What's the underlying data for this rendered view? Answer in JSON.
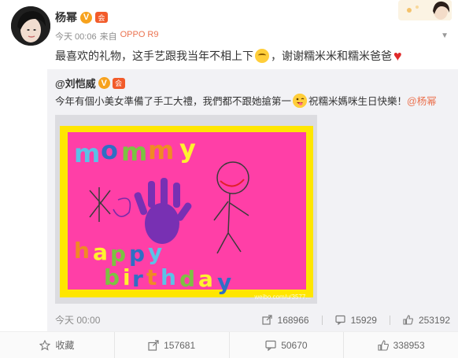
{
  "author": {
    "name": "杨幂",
    "v_badge": "V",
    "member_badge": "会"
  },
  "meta": {
    "time": "今天 00:06",
    "source_prefix": "来自",
    "device": "OPPO R9"
  },
  "post": {
    "text_before": "最喜欢的礼物，这手艺跟我当年不相上下",
    "text_after": "，谢谢糯米米和糯米爸爸"
  },
  "repost": {
    "author": "@刘恺威",
    "v_badge": "V",
    "member_badge": "会",
    "text_before": "今年有個小美女準備了手工大禮，我們都不跟她搶第一",
    "text_after": "祝糯米媽咪生日快樂！",
    "mention": "@杨幂",
    "photo_credit": "weibo.com/u/3577...",
    "time": "今天 00:00",
    "stats": {
      "reposts": "168966",
      "comments": "15929",
      "likes": "253192"
    }
  },
  "actions": {
    "favorite": "收藏",
    "repost": "157681",
    "comment": "50670",
    "like": "338953"
  },
  "colors": {
    "accent": "#eb7350",
    "card_pink": "#ff3fa7",
    "card_border": "#ffe600"
  }
}
